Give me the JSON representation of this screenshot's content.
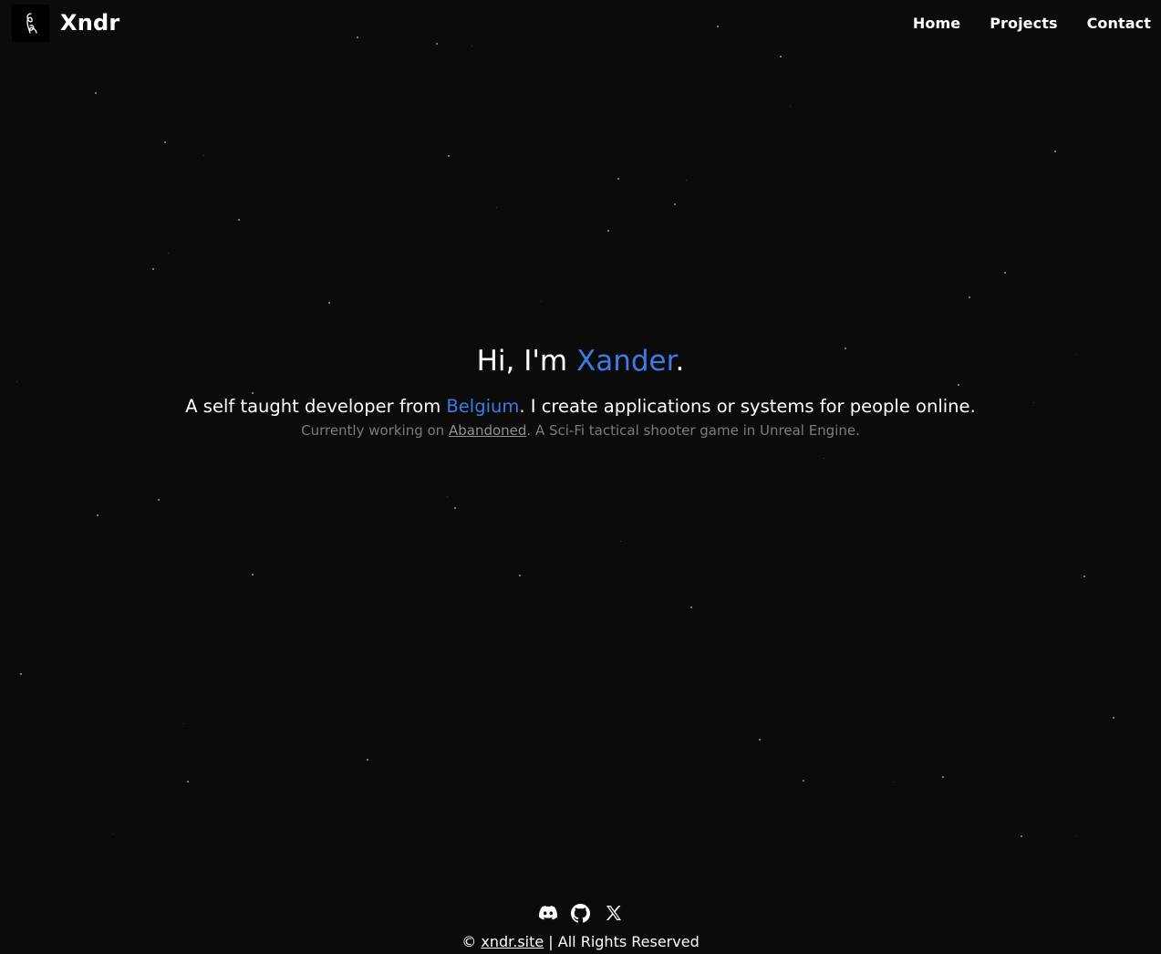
{
  "header": {
    "brand_name": "Xndr",
    "nav": [
      {
        "label": "Home"
      },
      {
        "label": "Projects"
      },
      {
        "label": "Contact"
      }
    ]
  },
  "hero": {
    "greeting_prefix": "Hi, I'm ",
    "greeting_name": "Xander",
    "greeting_suffix": ".",
    "sub_prefix": "A self taught developer from ",
    "sub_country": "Belgium",
    "sub_suffix": ". I create applications or systems for people online.",
    "note_prefix": "Currently working on ",
    "note_link": "Abandoned",
    "note_suffix": ". A Sci-Fi tactical shooter game in Unreal Engine."
  },
  "footer": {
    "icons": [
      "discord-icon",
      "github-icon",
      "x-icon"
    ],
    "copyright_symbol": "© ",
    "site_link": "xndr.site",
    "rights": " | All Rights Reserved"
  },
  "colors": {
    "background": "#0b0b0b",
    "accent": "#3d7be6",
    "text": "#ffffff",
    "muted": "#7c7c7c"
  }
}
